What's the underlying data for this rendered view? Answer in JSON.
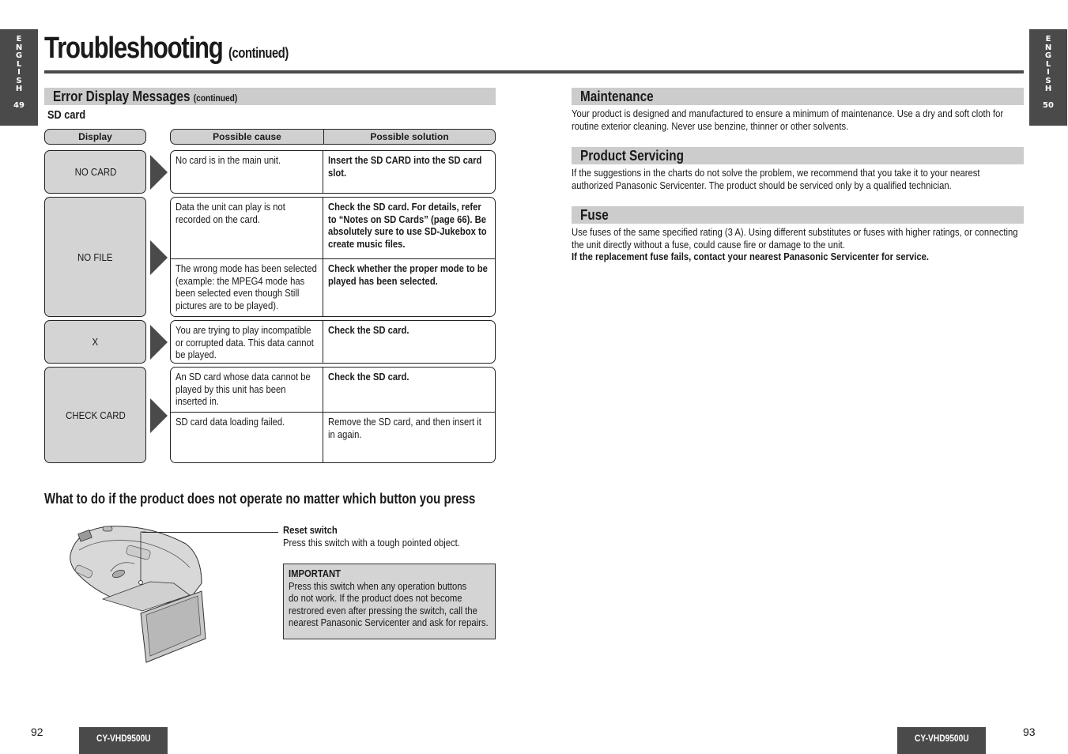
{
  "side_tabs": {
    "letters": [
      "E",
      "N",
      "G",
      "L",
      "I",
      "S",
      "H"
    ],
    "left_page": "49",
    "right_page": "50"
  },
  "header": {
    "title": "Troubleshooting",
    "title_suffix": "(continued)"
  },
  "left": {
    "section_title": "Error Display Messages",
    "section_suffix": "(continued)",
    "subsection": "SD card",
    "table_headers": {
      "display": "Display",
      "cause": "Possible cause",
      "solution": "Possible solution"
    },
    "rows": [
      {
        "display": "NO CARD",
        "items": [
          {
            "cause": "No card is in the main unit.",
            "solution": "Insert the SD CARD into the SD card slot.",
            "solution_bold": true
          }
        ]
      },
      {
        "display": "NO FILE",
        "items": [
          {
            "cause": "Data the unit can play is not recorded on the card.",
            "solution": "Check the SD card. For details, refer to “Notes on SD Cards” (page 66). Be absolutely sure to use SD-Jukebox to create music files.",
            "solution_bold": true
          },
          {
            "cause": "The wrong mode has been selected (example: the MPEG4 mode has been selected even though Still pictures are to be played).",
            "solution": "Check whether the proper mode to be played has been selected.",
            "solution_bold": true
          }
        ]
      },
      {
        "display": "X",
        "items": [
          {
            "cause": "You are trying to play incompatible or corrupted data. This data cannot be played.",
            "solution": "Check the SD card.",
            "solution_bold": true
          }
        ]
      },
      {
        "display": "CHECK CARD",
        "items": [
          {
            "cause": "An SD card whose data cannot be played by this unit has been inserted in.",
            "solution": "Check the SD card.",
            "solution_bold": true
          },
          {
            "cause": "SD card data loading failed.",
            "solution": "Remove the SD card, and then insert it in again.",
            "solution_bold": false
          }
        ]
      }
    ],
    "reset_section": {
      "heading": "What to do if the product does not operate no matter which button you press",
      "callout_label": "Reset switch",
      "callout_text": "Press this switch with a tough pointed object.",
      "important_title": "IMPORTANT",
      "important_lines": [
        "Press this switch when any operation buttons",
        "do not work. If the product does not become",
        "restrored even after pressing the switch, call the",
        "nearest Panasonic Servicenter and ask for repairs."
      ]
    }
  },
  "right": {
    "maintenance": {
      "title": "Maintenance",
      "text": "Your product is designed and manufactured to ensure a minimum of maintenance. Use a dry and soft cloth for routine exterior cleaning. Never use benzine, thinner or other solvents."
    },
    "servicing": {
      "title": "Product Servicing",
      "text": "If the suggestions in the charts do not solve the problem, we recommend that you take it to your nearest authorized Panasonic Servicenter. The product should be serviced only by a qualified technician."
    },
    "fuse": {
      "title": "Fuse",
      "text": "Use fuses of the same specified rating (3 A). Using different substitutes or fuses with higher ratings, or connecting the unit directly without a fuse, could cause fire or damage to the unit.",
      "warning": "If the replacement fuse fails, contact your nearest Panasonic Servicenter for service."
    }
  },
  "footer": {
    "left_page": "92",
    "right_page": "93",
    "model": "CY-VHD9500U"
  }
}
